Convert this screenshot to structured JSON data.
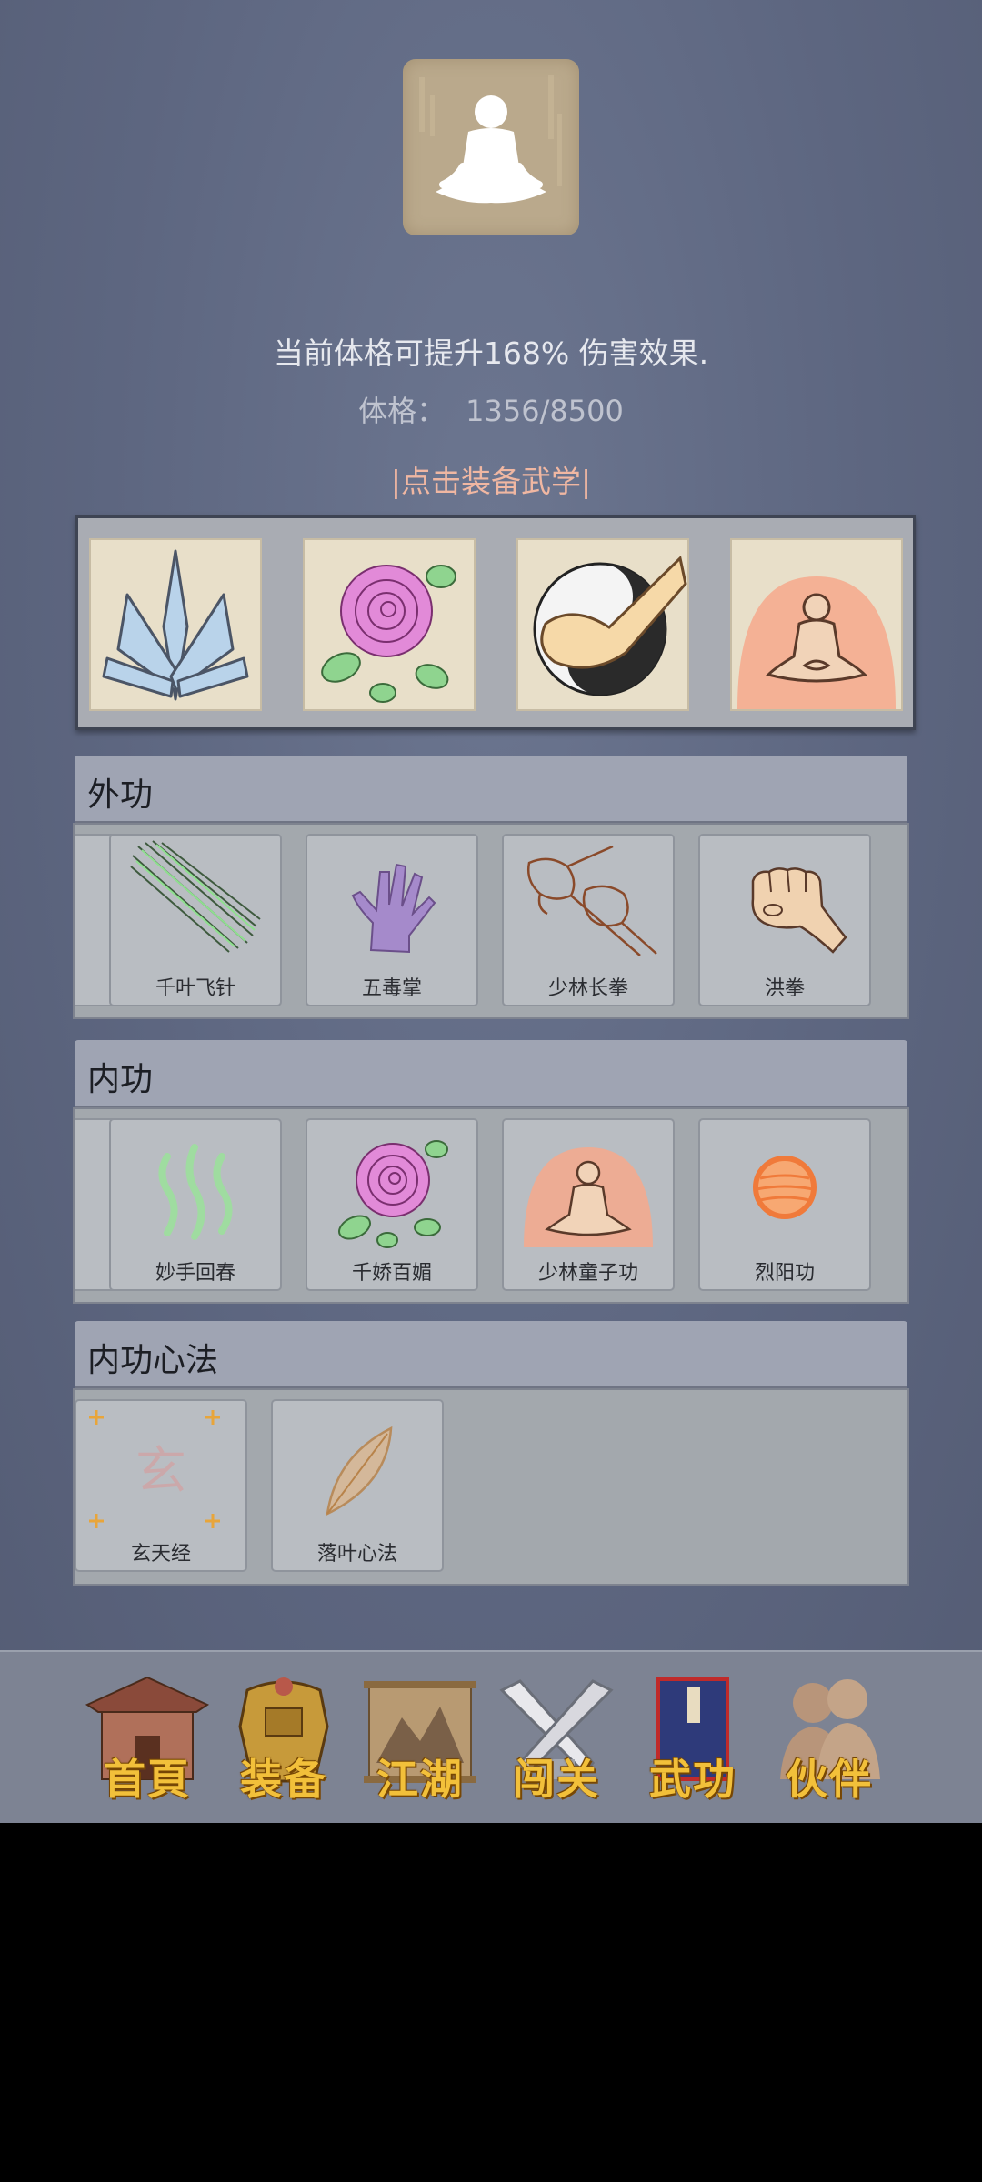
{
  "hero": {
    "avatar_icon": "meditation-figure-icon",
    "description": "当前体格可提升168% 伤害效果.",
    "stat_label": "体格：",
    "stat_value": "1356/8500",
    "equip_link": "|点击装备武学|"
  },
  "equipped": {
    "slots": [
      {
        "icon": "ice-crystal-icon"
      },
      {
        "icon": "rose-icon"
      },
      {
        "icon": "yin-yang-fist-icon"
      },
      {
        "icon": "meditating-aura-icon"
      }
    ]
  },
  "external": {
    "title": "外功",
    "skills": [
      {
        "label": "千叶飞针",
        "icon": "flying-needles-icon"
      },
      {
        "label": "五毒掌",
        "icon": "poison-palm-icon"
      },
      {
        "label": "少林长拳",
        "icon": "shaolin-fists-icon"
      },
      {
        "label": "洪拳",
        "icon": "fist-icon"
      }
    ]
  },
  "internal": {
    "title": "内功",
    "skills": [
      {
        "label": "妙手回春",
        "icon": "green-wisps-icon"
      },
      {
        "label": "千娇百媚",
        "icon": "rose-icon"
      },
      {
        "label": "少林童子功",
        "icon": "meditating-aura-icon"
      },
      {
        "label": "烈阳功",
        "icon": "sun-orb-icon"
      }
    ]
  },
  "mind": {
    "title": "内功心法",
    "skills": [
      {
        "label": "玄天经",
        "icon": "xuan-glyph-icon",
        "glyph": "玄"
      },
      {
        "label": "落叶心法",
        "icon": "leaf-icon"
      }
    ]
  },
  "nav": {
    "items": [
      {
        "label": "首頁",
        "icon": "house-icon"
      },
      {
        "label": "装备",
        "icon": "armor-icon"
      },
      {
        "label": "江湖",
        "icon": "scroll-map-icon"
      },
      {
        "label": "闯关",
        "icon": "crossed-swords-icon"
      },
      {
        "label": "武功",
        "icon": "book-icon"
      },
      {
        "label": "伙伴",
        "icon": "companions-icon"
      }
    ]
  },
  "colors": {
    "background": "#5d6680",
    "accent_link": "#f0b7a2",
    "nav_text": "#f2c03a"
  }
}
